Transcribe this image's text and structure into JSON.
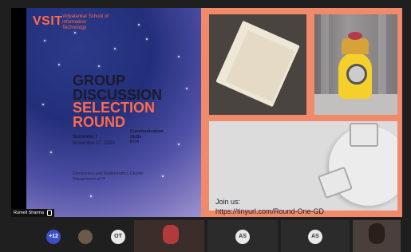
{
  "slide": {
    "logo": "VSIT",
    "logo_subtitle": "Vidyalankar School of Information Technology",
    "title_line1": "GROUP",
    "title_line2": "DISCUSSION",
    "title_line3": "SELECTION",
    "title_line4": "ROUND",
    "semester": "Semester I",
    "date": "November 07, 2020",
    "subject_line1": "Communication",
    "subject_line2": "Skills",
    "subject_line3": "BSA",
    "department_line1": "Electronics and Mathematics Cluster",
    "department_line2": "Department of IT",
    "join_label": "Join us:",
    "join_link": "https://tinyurl.com/Round-One-GD"
  },
  "presenter": {
    "name": "Rumeli Sharma"
  },
  "participants": {
    "overflow_count": "+12",
    "initials": [
      "OT",
      "AS",
      "AS"
    ]
  },
  "colors": {
    "accent": "#ff6a4c",
    "panel_pink": "#f08a6a",
    "avatar_blue": "#3c4fc7"
  }
}
